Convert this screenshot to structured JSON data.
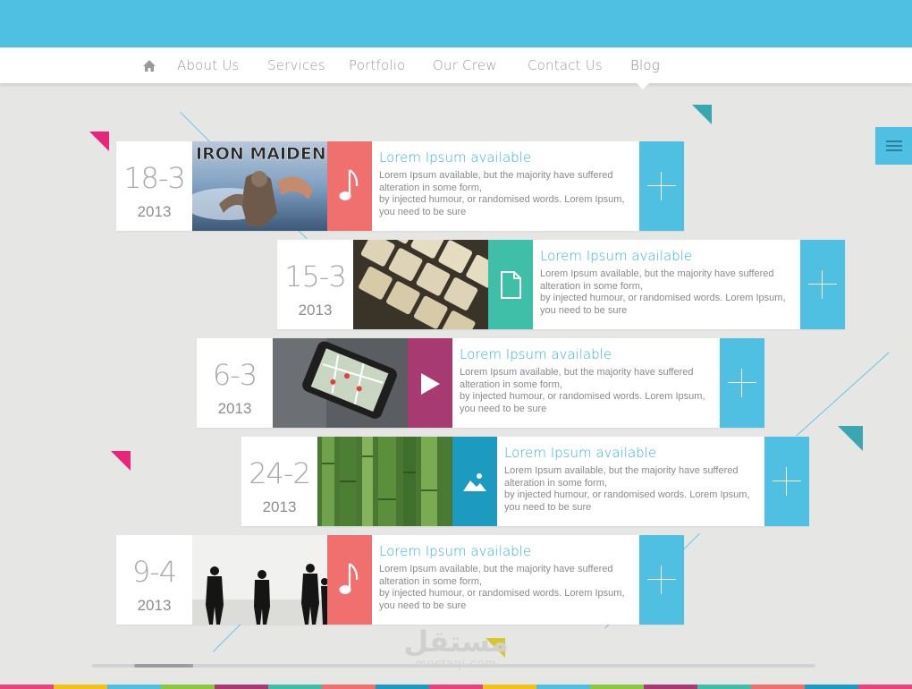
{
  "nav": {
    "items": [
      {
        "label": "About Us"
      },
      {
        "label": "Services"
      },
      {
        "label": "Portfolio"
      },
      {
        "label": "Our Crew"
      },
      {
        "label": "Contact Us"
      },
      {
        "label": "Blog",
        "active": true
      }
    ]
  },
  "posts": [
    {
      "day": "18-3",
      "year": "2013",
      "image": "iron-maiden-album-art",
      "image_text": "IRON MAIDEN",
      "category_icon": "music-note-icon",
      "category_color": "#f07070",
      "title": "Lorem Ipsum available",
      "body_lines": [
        "Lorem Ipsum available, but the majority have suffered",
        "alteration in some form,",
        "by injected humour, or randomised words. Lorem Ipsum,",
        "you need to be sure"
      ]
    },
    {
      "day": "15-3",
      "year": "2013",
      "image": "keyboard-keys-photo",
      "category_icon": "document-icon",
      "category_color": "#3fbfa8",
      "title": "Lorem Ipsum available",
      "body_lines": [
        "Lorem Ipsum available, but the majority have suffered",
        "alteration in some form,",
        "by injected humour, or randomised words. Lorem Ipsum,",
        "you need to be sure"
      ]
    },
    {
      "day": "6-3",
      "year": "2013",
      "image": "smartphone-map-photo",
      "category_icon": "play-icon",
      "category_color": "#a83a72",
      "title": "Lorem Ipsum available",
      "body_lines": [
        "Lorem Ipsum available, but the majority have suffered",
        "alteration in some form,",
        "by injected humour, or randomised words. Lorem Ipsum,",
        "you need to be sure"
      ]
    },
    {
      "day": "24-2",
      "year": "2013",
      "image": "bamboo-forest-photo",
      "category_icon": "image-icon",
      "category_color": "#1d9ac0",
      "title": "Lorem Ipsum available",
      "body_lines": [
        "Lorem Ipsum available, but the majority have suffered",
        "alteration in some form,",
        "by injected humour, or randomised words. Lorem Ipsum,",
        "you need to be sure"
      ]
    },
    {
      "day": "9-4",
      "year": "2013",
      "image": "band-silhouettes-photo",
      "category_icon": "music-note-icon",
      "category_color": "#f07070",
      "title": "Lorem Ipsum available",
      "body_lines": [
        "Lorem Ipsum available, but the majority have suffered",
        "alteration in some form,",
        "by injected humour, or randomised words. Lorem Ipsum,",
        "you need to be sure"
      ]
    }
  ],
  "watermark": {
    "arabic": "مستقل",
    "latin": "mostaqi.com"
  },
  "colors": {
    "accent": "#4fbfe2",
    "strip": [
      "#e8437a",
      "#f2c21b",
      "#4fbfe2",
      "#8dc63f",
      "#a83a72",
      "#3fbfa8",
      "#f07070",
      "#1d9ac0",
      "#e8437a",
      "#f2c21b",
      "#4fbfe2",
      "#8dc63f",
      "#a83a72",
      "#3fbfa8",
      "#f07070",
      "#1d9ac0",
      "#e8437a"
    ]
  }
}
